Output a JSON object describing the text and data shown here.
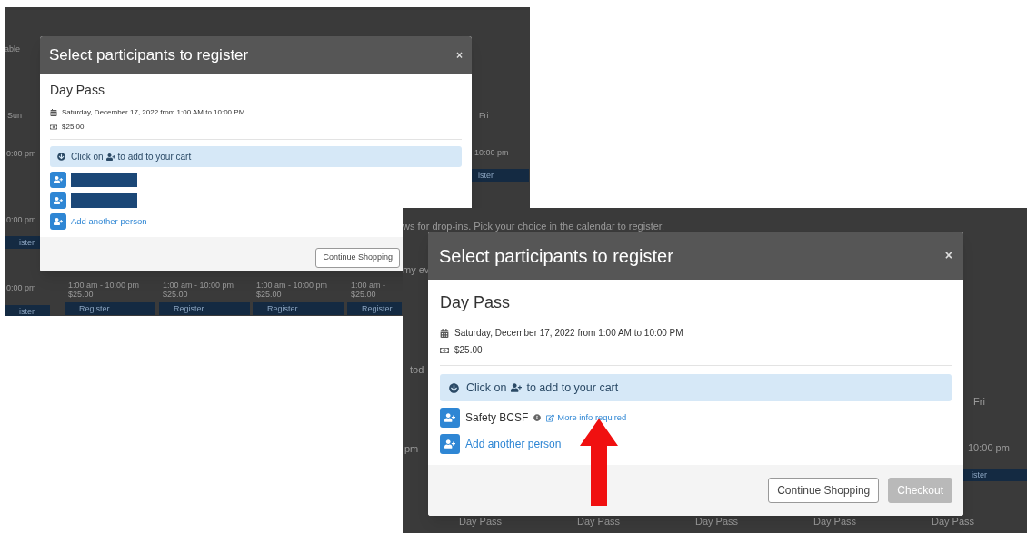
{
  "screenshots": [
    {
      "background_texts": [
        "able",
        "Sun",
        "0:00 pm",
        "0:00 pm",
        "ister",
        "0:00 pm",
        "ister",
        "Fri",
        "10:00 pm",
        "ister",
        "1:00 am - 10:00 pm",
        "$25.00",
        "Register",
        "1:00 am - 10:00 pm",
        "$25.00",
        "Register",
        "1:00 am - 10:00 pm",
        "$25.00",
        "Register",
        "1:00 am -",
        "$25.00",
        "Register"
      ],
      "modal": {
        "title": "Select participants to register",
        "close": "×",
        "event_title": "Day Pass",
        "date": "Saturday, December 17, 2022 from 1:00 AM to 10:00 PM",
        "price": "$25.00",
        "hint_before": "Click on",
        "hint_after": "to add to your cart",
        "participants": [
          {
            "kind": "redacted"
          },
          {
            "kind": "redacted"
          },
          {
            "kind": "add",
            "label": "Add another person"
          }
        ],
        "buttons": [
          {
            "label": "Continue Shopping",
            "disabled": false
          }
        ]
      }
    },
    {
      "background_texts": [
        "ws for drop-ins. Pick your choice in the calendar to register.",
        "my ev",
        "tod",
        "Fri",
        "pm",
        "10:00 pm",
        "ister",
        "Day Pass",
        "Day Pass",
        "Day Pass",
        "Day Pass",
        "Day Pass"
      ],
      "modal": {
        "title": "Select participants to register",
        "close": "×",
        "event_title": "Day Pass",
        "date": "Saturday, December 17, 2022 from 1:00 AM to 10:00 PM",
        "price": "$25.00",
        "hint_before": "Click on",
        "hint_after": "to add to your cart",
        "participants": [
          {
            "kind": "named",
            "name": "Safety BCSF",
            "link": "More info required"
          },
          {
            "kind": "add",
            "label": "Add another person"
          }
        ],
        "buttons": [
          {
            "label": "Continue Shopping",
            "disabled": false
          },
          {
            "label": "Checkout",
            "disabled": true
          }
        ]
      },
      "annotations": [
        {
          "kind": "arrow"
        }
      ]
    }
  ]
}
